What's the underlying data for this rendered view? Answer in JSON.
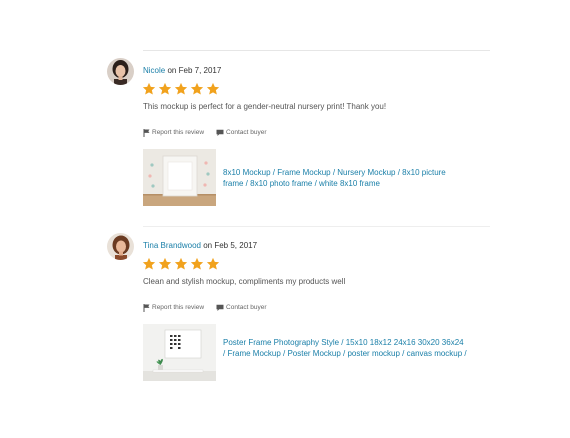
{
  "reviews": [
    {
      "name": "Nicole",
      "date_prefix": "on",
      "date": "Feb 7, 2017",
      "rating": 5,
      "text": "This mockup is perfect for a gender-neutral nursery print! Thank you!",
      "report_label": "Report this review",
      "contact_label": "Contact buyer",
      "listing_title": "8x10 Mockup / Frame Mockup / Nursery Mockup / 8x10 picture frame / 8x10 photo frame / white 8x10 frame"
    },
    {
      "name": "Tina Brandwood",
      "date_prefix": "on",
      "date": "Feb 5, 2017",
      "rating": 5,
      "text": "Clean and stylish mockup, compliments my products well",
      "report_label": "Report this review",
      "contact_label": "Contact buyer",
      "listing_title": "Poster Frame Photography Style / 15x10 18x12 24x16 30x20 36x24 / Frame Mockup / Poster Mockup / poster mockup / canvas mockup /"
    }
  ],
  "colors": {
    "link": "#1a7fa8",
    "star": "#f1a21d"
  },
  "icons": {
    "report": "flag-icon",
    "contact": "speech-bubble-icon",
    "rating": "star-icon"
  }
}
